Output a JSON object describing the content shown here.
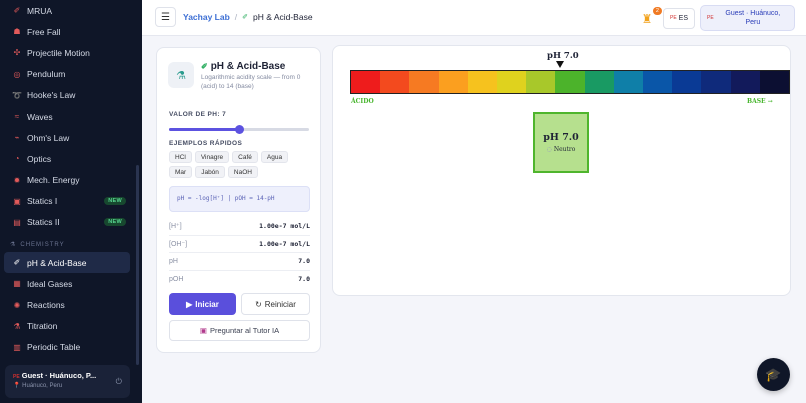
{
  "sidebar": {
    "items_top": [
      {
        "label": "MRUA",
        "icon": "✐",
        "badge": ""
      },
      {
        "label": "Free Fall",
        "icon": "☗",
        "badge": ""
      },
      {
        "label": "Projectile Motion",
        "icon": "✣",
        "badge": ""
      },
      {
        "label": "Pendulum",
        "icon": "◎",
        "badge": ""
      },
      {
        "label": "Hooke's Law",
        "icon": "➰",
        "badge": ""
      },
      {
        "label": "Waves",
        "icon": "≈",
        "badge": ""
      },
      {
        "label": "Ohm's Law",
        "icon": "⌁",
        "badge": ""
      },
      {
        "label": "Optics",
        "icon": "◔",
        "badge": ""
      },
      {
        "label": "Mech. Energy",
        "icon": "✹",
        "badge": ""
      },
      {
        "label": "Statics I",
        "icon": "▣",
        "badge": "NEW"
      },
      {
        "label": "Statics II",
        "icon": "▤",
        "badge": "NEW"
      }
    ],
    "section_chemistry": "CHEMISTRY",
    "items_chem": [
      {
        "label": "pH & Acid-Base",
        "icon": "✐",
        "active": true
      },
      {
        "label": "Ideal Gases",
        "icon": "▦",
        "active": false
      },
      {
        "label": "Reactions",
        "icon": "✺",
        "active": false
      },
      {
        "label": "Titration",
        "icon": "⚗",
        "active": false
      },
      {
        "label": "Periodic Table",
        "icon": "▥",
        "active": false
      }
    ],
    "user": {
      "name": "Guest · Huánuco, P...",
      "flag": "PE",
      "location": "Huánuco, Peru"
    }
  },
  "header": {
    "breadcrumb_root": "Yachay Lab",
    "breadcrumb_sep": "/",
    "breadcrumb_current": "pH & Acid-Base",
    "streak_count": "2",
    "lang_flag": "PE",
    "lang_code": "ES",
    "user_flag": "PE",
    "user_label": "Guest · Huánuco, Peru"
  },
  "panel": {
    "title": "pH & Acid-Base",
    "subtitle": "Logarithmic acidity scale — from 0 (acid) to 14 (base)",
    "ph_label": "VALOR DE PH: 7",
    "ph_value": 7,
    "ph_min": 0,
    "ph_max": 14,
    "examples_label": "EJEMPLOS RÁPIDOS",
    "examples": [
      "HCl",
      "Vinagre",
      "Café",
      "Agua",
      "Mar",
      "Jabón",
      "NaOH"
    ],
    "formula": "pH = -log[H⁺] | pOH = 14-pH",
    "readouts": [
      {
        "key": "[H⁺]",
        "value": "1.00e-7 mol/L"
      },
      {
        "key": "[OH⁻]",
        "value": "1.00e-7 mol/L"
      },
      {
        "key": "pH",
        "value": "7.0"
      },
      {
        "key": "pOH",
        "value": "7.0"
      }
    ],
    "start_label": "Iniciar",
    "reset_label": "Reiniciar",
    "tutor_label": "Preguntar al Tutor IA"
  },
  "visual": {
    "marker_label": "pH 7.0",
    "marker_value": 7,
    "scale_colors": [
      "#ee1c1c",
      "#f34a1e",
      "#f67a22",
      "#fb9f1f",
      "#f6c21e",
      "#dfd21e",
      "#a8c82a",
      "#4cb32b",
      "#199a63",
      "#0f7fa8",
      "#0a56a8",
      "#0a3a95",
      "#0f2a7b",
      "#121a5b",
      "#0c0f32"
    ],
    "left_end": "ÁCIDO",
    "right_end": "BASE →",
    "box_value": "pH 7.0",
    "box_status": "Neutro"
  }
}
